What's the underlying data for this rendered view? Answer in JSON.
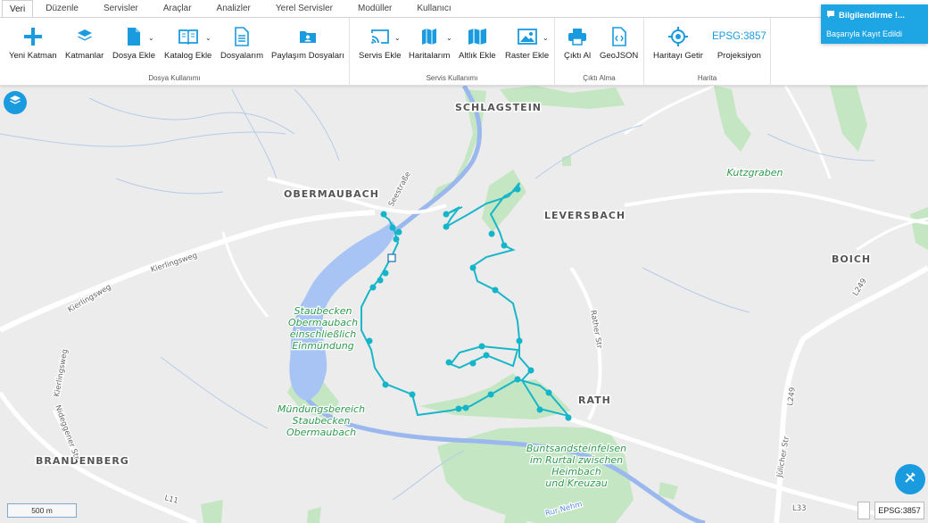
{
  "tabs": [
    "Veri",
    "Düzenle",
    "Servisler",
    "Araçlar",
    "Analizler",
    "Yerel Servisler",
    "Modüller",
    "Kullanıcı"
  ],
  "ribbon": {
    "file_group": {
      "label": "Dosya Kullanımı",
      "new_layer": "Yeni Katman",
      "layers": "Katmanlar",
      "add_file": "Dosya Ekle",
      "add_catalog": "Katalog Ekle",
      "my_files": "Dosyalarım",
      "shared_files": "Paylaşım Dosyaları"
    },
    "service_group": {
      "label": "Servis Kullanımı",
      "add_service": "Servis Ekle",
      "my_maps": "Haritalarım",
      "add_basemap": "Altlık Ekle",
      "add_raster": "Raster Ekle"
    },
    "output_group": {
      "label": "Çıktı Alma",
      "print": "Çıktı Al",
      "geojson": "GeoJSON"
    },
    "map_group": {
      "label": "Harita",
      "get_map": "Haritayı Getir",
      "epsg": "EPSG:3857",
      "projection": "Projeksiyon"
    }
  },
  "notification": {
    "title": "Bilgilendirme !...",
    "message": "Başarıyla Kayıt Edildi"
  },
  "map": {
    "places": [
      "SCHLAGSTEIN",
      "OBERMAUBACH",
      "LEVERSBACH",
      "BOICH",
      "RATH",
      "BRANDENBERG"
    ],
    "water_labels": [
      "Staubecken",
      "Obermaubach",
      "einschließlich",
      "Einmündung"
    ],
    "water_labels2": [
      "Mündungsbereich",
      "Staubecken",
      "Obermaubach"
    ],
    "forest_labels": [
      "Buntsandsteinfelsen",
      "im Rurtal zwischen",
      "Heimbach",
      "und Kreuzau"
    ],
    "kutzgraben": "Kutzgraben",
    "roads": [
      "Kierlingsweg",
      "Kierlingsweg",
      "Kierlingsweg",
      "Nideggener Str",
      "Seestraße",
      "Rather Str",
      "L249",
      "L249",
      "Jülicher Str",
      "L33",
      "L11",
      "Rur Nehm"
    ],
    "scale": "500 m",
    "epsg": "EPSG:3857"
  },
  "colors": {
    "accent": "#1a9be0",
    "track": "#13b5c9",
    "water": "#a7c4f2",
    "green": "#bfe5c0",
    "river": "#7fa4e6"
  }
}
